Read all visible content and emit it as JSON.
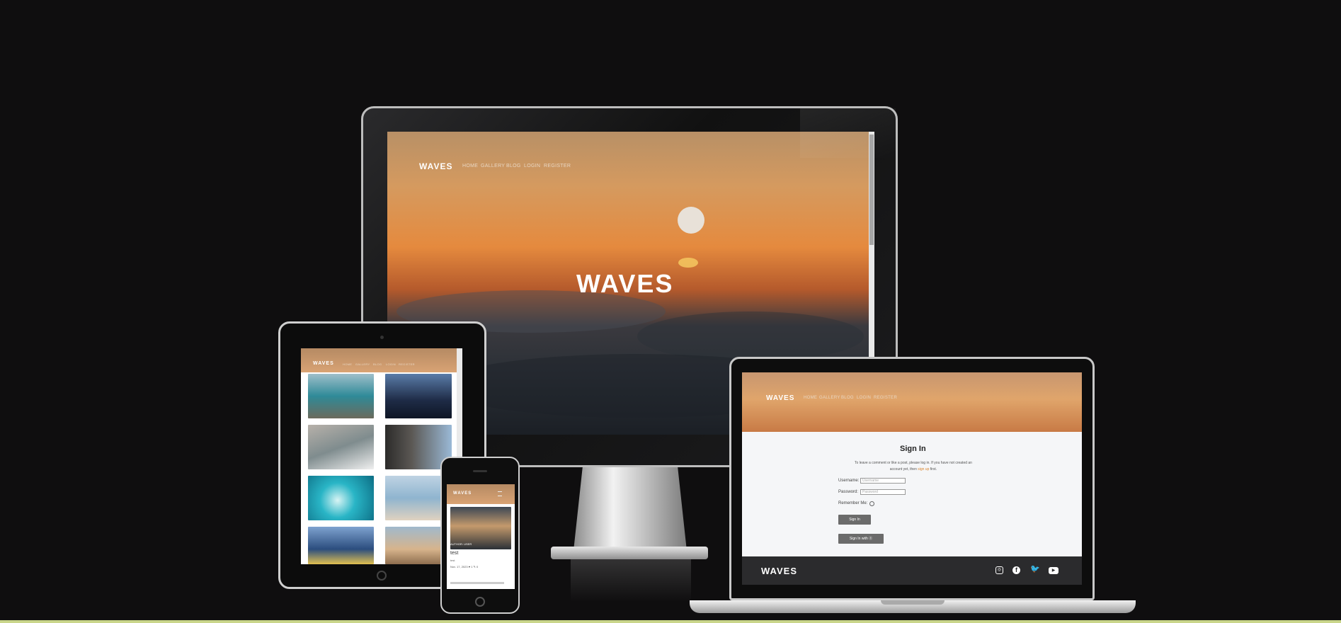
{
  "brand": {
    "logo": "WAVES"
  },
  "desktop": {
    "nav": [
      "HOME",
      "GALLERY",
      "BLOG",
      "LOGIN",
      "REGISTER"
    ],
    "hero_logo": "WAVES"
  },
  "tablet": {
    "nav": [
      "HOME",
      "GALLERY",
      "BLOG",
      "LOGIN",
      "REGISTER"
    ],
    "gallery_colors": [
      "#4f8fa0",
      "#2a3a56",
      "#8a8f92",
      "#506a84",
      "#2fb3c3",
      "#9fbbd0",
      "#3c5d86",
      "#d7c0a2"
    ]
  },
  "phone": {
    "author_label": "AUTHOR: USER",
    "post_title": "test",
    "post_excerpt": "test",
    "post_meta": "Nov. 17, 2023 ♥ 1 ✎ 0"
  },
  "laptop": {
    "nav": [
      "HOME",
      "GALLERY",
      "BLOG",
      "LOGIN",
      "REGISTER"
    ],
    "title": "Sign In",
    "intro_1": "To leave a comment or like a post, please log in. If you have not created an",
    "intro_2a": "account yet, then ",
    "intro_link": "sign up",
    "intro_2b": " first.",
    "username_label": "Username:",
    "username_placeholder": "Username",
    "password_label": "Password:",
    "password_placeholder": "Password",
    "remember_label": "Remember Me:",
    "signin_button": "Sign In",
    "signin_with_button": "Sign In with ⓖ",
    "social": [
      "instagram-icon",
      "facebook-icon",
      "twitter-icon",
      "youtube-icon"
    ]
  },
  "colors": {
    "background": "#0f0e0f",
    "accent": "#d9832b"
  }
}
